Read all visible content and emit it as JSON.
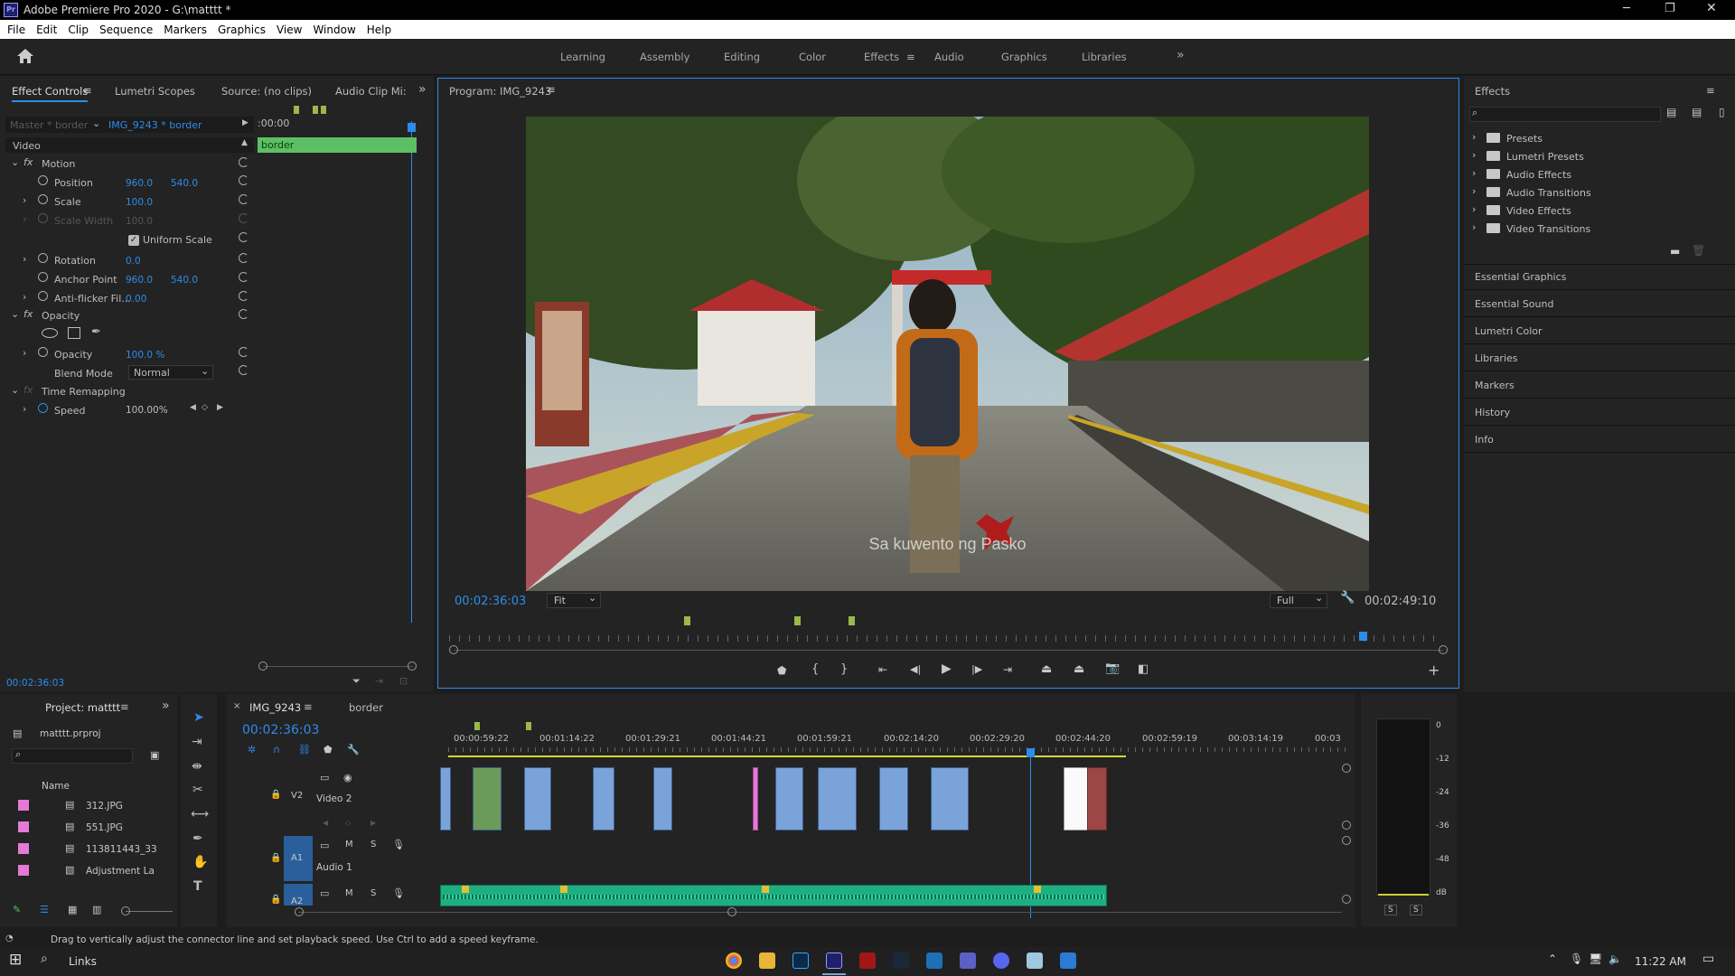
{
  "app": {
    "title": "Adobe Premiere Pro 2020 - G:\\matttt *",
    "logo": "Pr"
  },
  "menu": [
    "File",
    "Edit",
    "Clip",
    "Sequence",
    "Markers",
    "Graphics",
    "View",
    "Window",
    "Help"
  ],
  "workspaces": [
    "Learning",
    "Assembly",
    "Editing",
    "Color",
    "Effects",
    "Audio",
    "Graphics",
    "Libraries"
  ],
  "workspace_active": "Effects",
  "effect_controls": {
    "tabs": [
      "Effect Controls",
      "Lumetri Scopes",
      "Source: (no clips)",
      "Audio Clip Mi:"
    ],
    "master": "Master * border",
    "clip": "IMG_9243 * border",
    "time_start": ":00:00",
    "clip_bar_label": "border",
    "section": "Video",
    "motion": "Motion",
    "position_label": "Position",
    "position_x": "960.0",
    "position_y": "540.0",
    "scale_label": "Scale",
    "scale": "100.0",
    "scale_width_label": "Scale Width",
    "scale_width": "100.0",
    "uniform_scale": "Uniform Scale",
    "rotation_label": "Rotation",
    "rotation": "0.0",
    "anchor_label": "Anchor Point",
    "anchor_x": "960.0",
    "anchor_y": "540.0",
    "antiflicker_label": "Anti-flicker Fil...",
    "antiflicker": "0.00",
    "opacity_section": "Opacity",
    "opacity_label": "Opacity",
    "opacity": "100.0 %",
    "blend_label": "Blend Mode",
    "blend_mode": "Normal",
    "time_remap": "Time Remapping",
    "speed_label": "Speed",
    "speed": "100.00%",
    "timecode": "00:02:36:03"
  },
  "program": {
    "title": "Program: IMG_9243",
    "timecode": "00:02:36:03",
    "fit": "Fit",
    "quality": "Full",
    "duration": "00:02:49:10",
    "subtitle": "Sa kuwento ng Pasko"
  },
  "effects_panel": {
    "title": "Effects",
    "folders": [
      "Presets",
      "Lumetri Presets",
      "Audio Effects",
      "Audio Transitions",
      "Video Effects",
      "Video Transitions"
    ],
    "side_panels": [
      "Essential Graphics",
      "Essential Sound",
      "Lumetri Color",
      "Libraries",
      "Markers",
      "History",
      "Info"
    ]
  },
  "project": {
    "title": "Project: matttt",
    "file": "matttt.prproj",
    "column": "Name",
    "items": [
      "312.JPG",
      "551.JPG",
      "113811443_33",
      "Adjustment La"
    ]
  },
  "timeline": {
    "tab": "IMG_9243",
    "tab2": "border",
    "timecode": "00:02:36:03",
    "ruler": [
      "00:00:59:22",
      "00:01:14:22",
      "00:01:29:21",
      "00:01:44:21",
      "00:01:59:21",
      "00:02:14:20",
      "00:02:29:20",
      "00:02:44:20",
      "00:02:59:19",
      "00:03:14:19",
      "00:03"
    ],
    "v2_label": "V2",
    "v2_name": "Video 2",
    "a1_label": "A1",
    "a1_name": "Audio 1",
    "a2_label": "A2"
  },
  "meters": [
    "0",
    "-12",
    "-24",
    "-36",
    "-48",
    "dB"
  ],
  "status": "Drag to vertically adjust the connector line and set playback speed. Use Ctrl to add a speed keyframe.",
  "taskbar": {
    "search": "Links",
    "time": "11:22 AM"
  },
  "colors": {
    "accent": "#2d8ceb",
    "video_clip": "#7aa3d9",
    "audio_clip": "#1fae82",
    "clip_bar": "#5dbf63"
  }
}
